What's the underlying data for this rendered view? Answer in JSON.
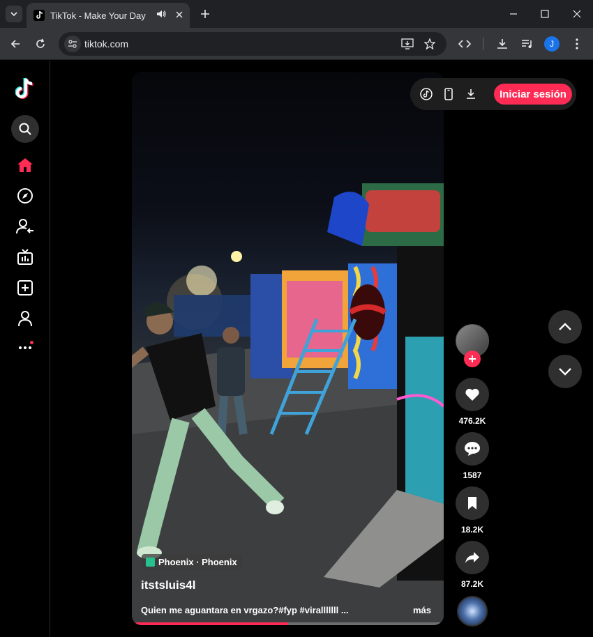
{
  "browser": {
    "tab_title": "TikTok - Make Your Day",
    "url": "tiktok.com",
    "profile_initial": "J"
  },
  "header": {
    "login_label": "Iniciar sesión"
  },
  "video": {
    "location": "Phoenix · Phoenix",
    "author": "itstsluis4l",
    "caption": "Quien me aguantara en vrgazo?#fyp #viralllllll ...",
    "more_label": "más",
    "progress": 0.5
  },
  "actions": {
    "likes": "476.2K",
    "comments": "1587",
    "saves": "18.2K",
    "shares": "87.2K"
  },
  "colors": {
    "accent": "#fe2c55",
    "chrome_dark": "#202124",
    "chrome_mid": "#35363a"
  }
}
